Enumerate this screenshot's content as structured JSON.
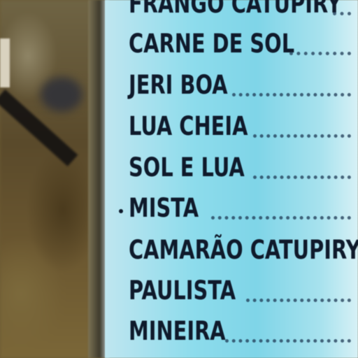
{
  "menu": {
    "items": [
      {
        "label": "FRANGO CATUPIRY"
      },
      {
        "label": "CARNE DE SOL"
      },
      {
        "label": "JERI BOA"
      },
      {
        "label": "LUA CHEIA"
      },
      {
        "label": "SOL E LUA"
      },
      {
        "label": "MISTA"
      },
      {
        "label": "CAMARÃO CATUPIRY"
      },
      {
        "label": "PAULISTA"
      },
      {
        "label": "MINEIRA"
      }
    ]
  },
  "colors": {
    "panel": "#8ddcec",
    "text": "#0f1a2b",
    "background": "#6b5a34"
  }
}
